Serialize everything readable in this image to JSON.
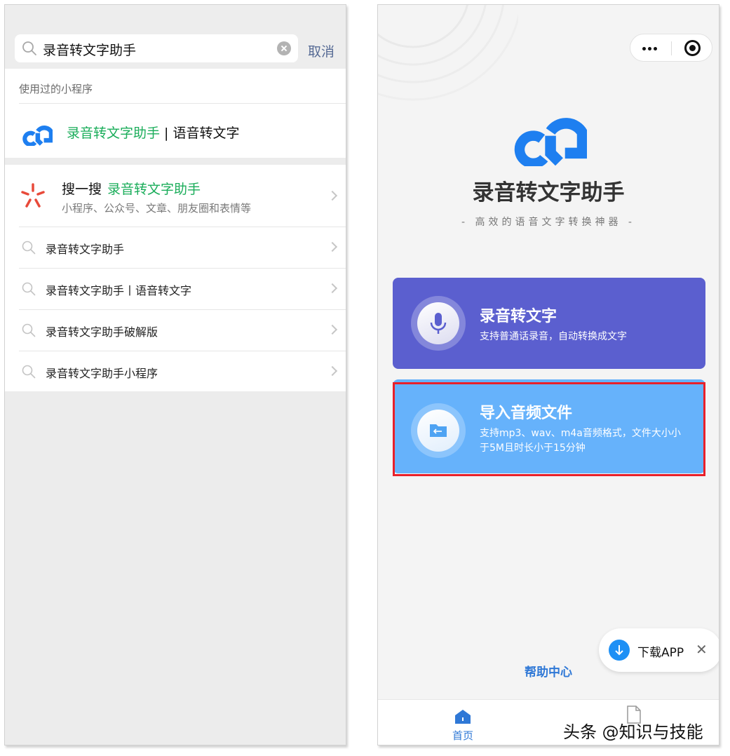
{
  "left": {
    "search": {
      "query": "录音转文字助手",
      "cancel_label": "取消"
    },
    "used_section": {
      "header": "使用过的小程序",
      "app": {
        "name_highlight": "录音转文字助手",
        "name_rest": " | 语音转文字"
      }
    },
    "souyisou": {
      "prefix": "搜一搜",
      "keyword": "录音转文字助手",
      "subtitle": "小程序、公众号、文章、朋友圈和表情等"
    },
    "suggestions": [
      "录音转文字助手",
      "录音转文字助手丨语音转文字",
      "录音转文字助手破解版",
      "录音转文字助手小程序"
    ]
  },
  "right": {
    "app_title": "录音转文字助手",
    "slogan": "- 高效的语音文字转换神器 -",
    "card_record": {
      "title": "录音转文字",
      "desc": "支持普通话录音，自动转换成文字"
    },
    "card_import": {
      "title": "导入音频文件",
      "desc": "支持mp3、wav、m4a音频格式，文件大小小于5M且时长小于15分钟"
    },
    "help_link": "帮助中心",
    "download": {
      "label": "下载APP"
    },
    "tabs": [
      {
        "label": "首页"
      }
    ],
    "colors": {
      "record_card": "#5b5fcf",
      "import_card": "#66b2fb",
      "highlight": "#e8202a",
      "brand_blue": "#1e7ff0",
      "wechat_green": "#1aad5a"
    }
  },
  "watermark": "头条 @知识与技能"
}
